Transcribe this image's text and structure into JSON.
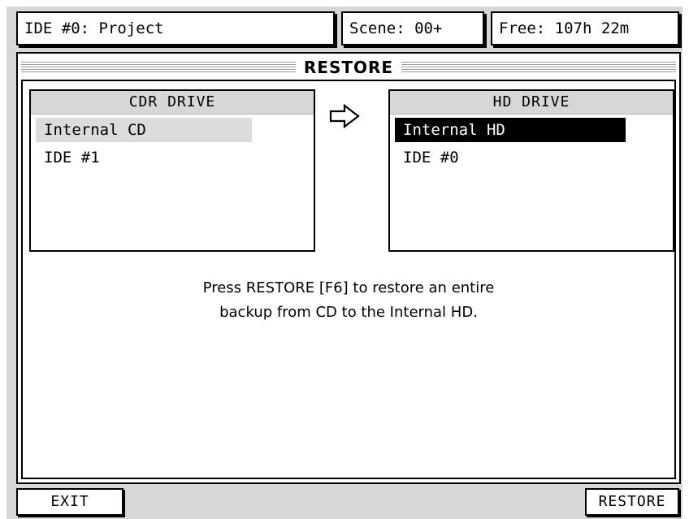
{
  "header": {
    "project": "IDE #0: Project",
    "scene": "Scene: 00+",
    "free": "Free: 107h 22m"
  },
  "panel": {
    "title": "RESTORE"
  },
  "source": {
    "header": "CDR DRIVE",
    "items": [
      "Internal CD",
      "IDE #1"
    ],
    "selected": "Internal CD"
  },
  "arrow_icon": "right-arrow-icon",
  "destination": {
    "header": "HD DRIVE",
    "items": [
      "Internal HD",
      "IDE #0"
    ],
    "selected": "Internal HD"
  },
  "message": {
    "line1": "Press RESTORE [F6] to restore an entire",
    "line2": "backup from CD to the Internal HD."
  },
  "buttons": {
    "exit": "EXIT",
    "restore": "RESTORE"
  },
  "colors": {
    "background": "#d7d7d7",
    "highlight_light": "#dcdcdc",
    "highlight_dark": "#000000"
  }
}
